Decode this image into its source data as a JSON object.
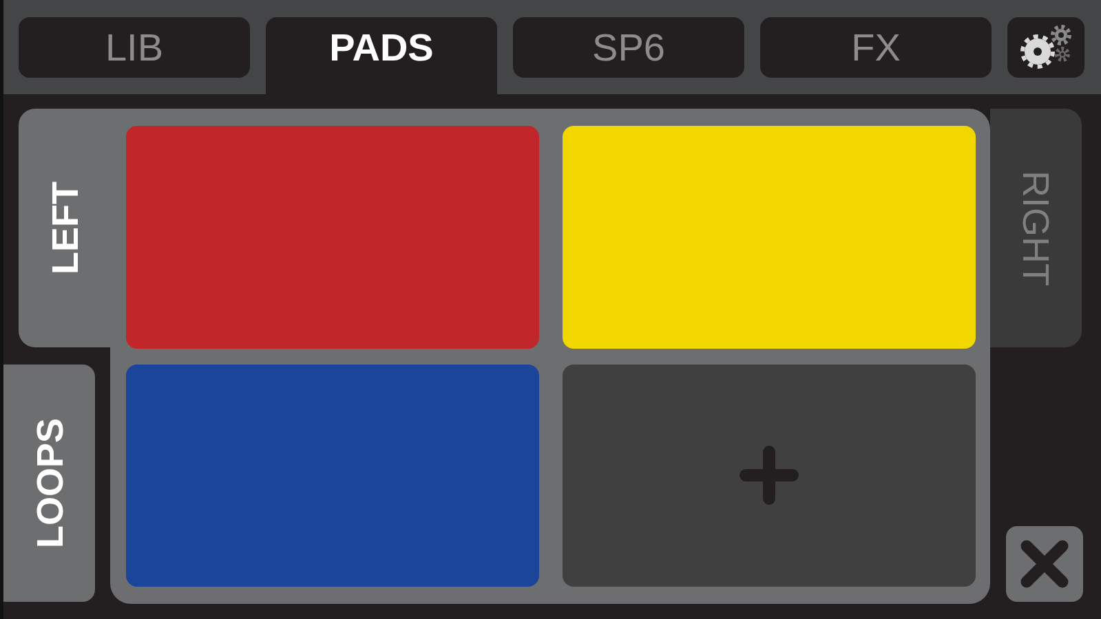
{
  "top_tabs": [
    {
      "label": "LIB",
      "selected": false
    },
    {
      "label": "PADS",
      "selected": true
    },
    {
      "label": "SP6",
      "selected": false
    },
    {
      "label": "FX",
      "selected": false
    }
  ],
  "deck_tabs": [
    {
      "label": "LEFT",
      "selected": true
    },
    {
      "label": "RIGHT",
      "selected": false
    }
  ],
  "loops_button": {
    "label": "LOOPS",
    "on": true
  },
  "pads": [
    {
      "kind": "sample",
      "color": "#c1262b"
    },
    {
      "kind": "sample",
      "color": "#f2d600"
    },
    {
      "kind": "sample",
      "color": "#1b4599"
    },
    {
      "kind": "add"
    }
  ]
}
